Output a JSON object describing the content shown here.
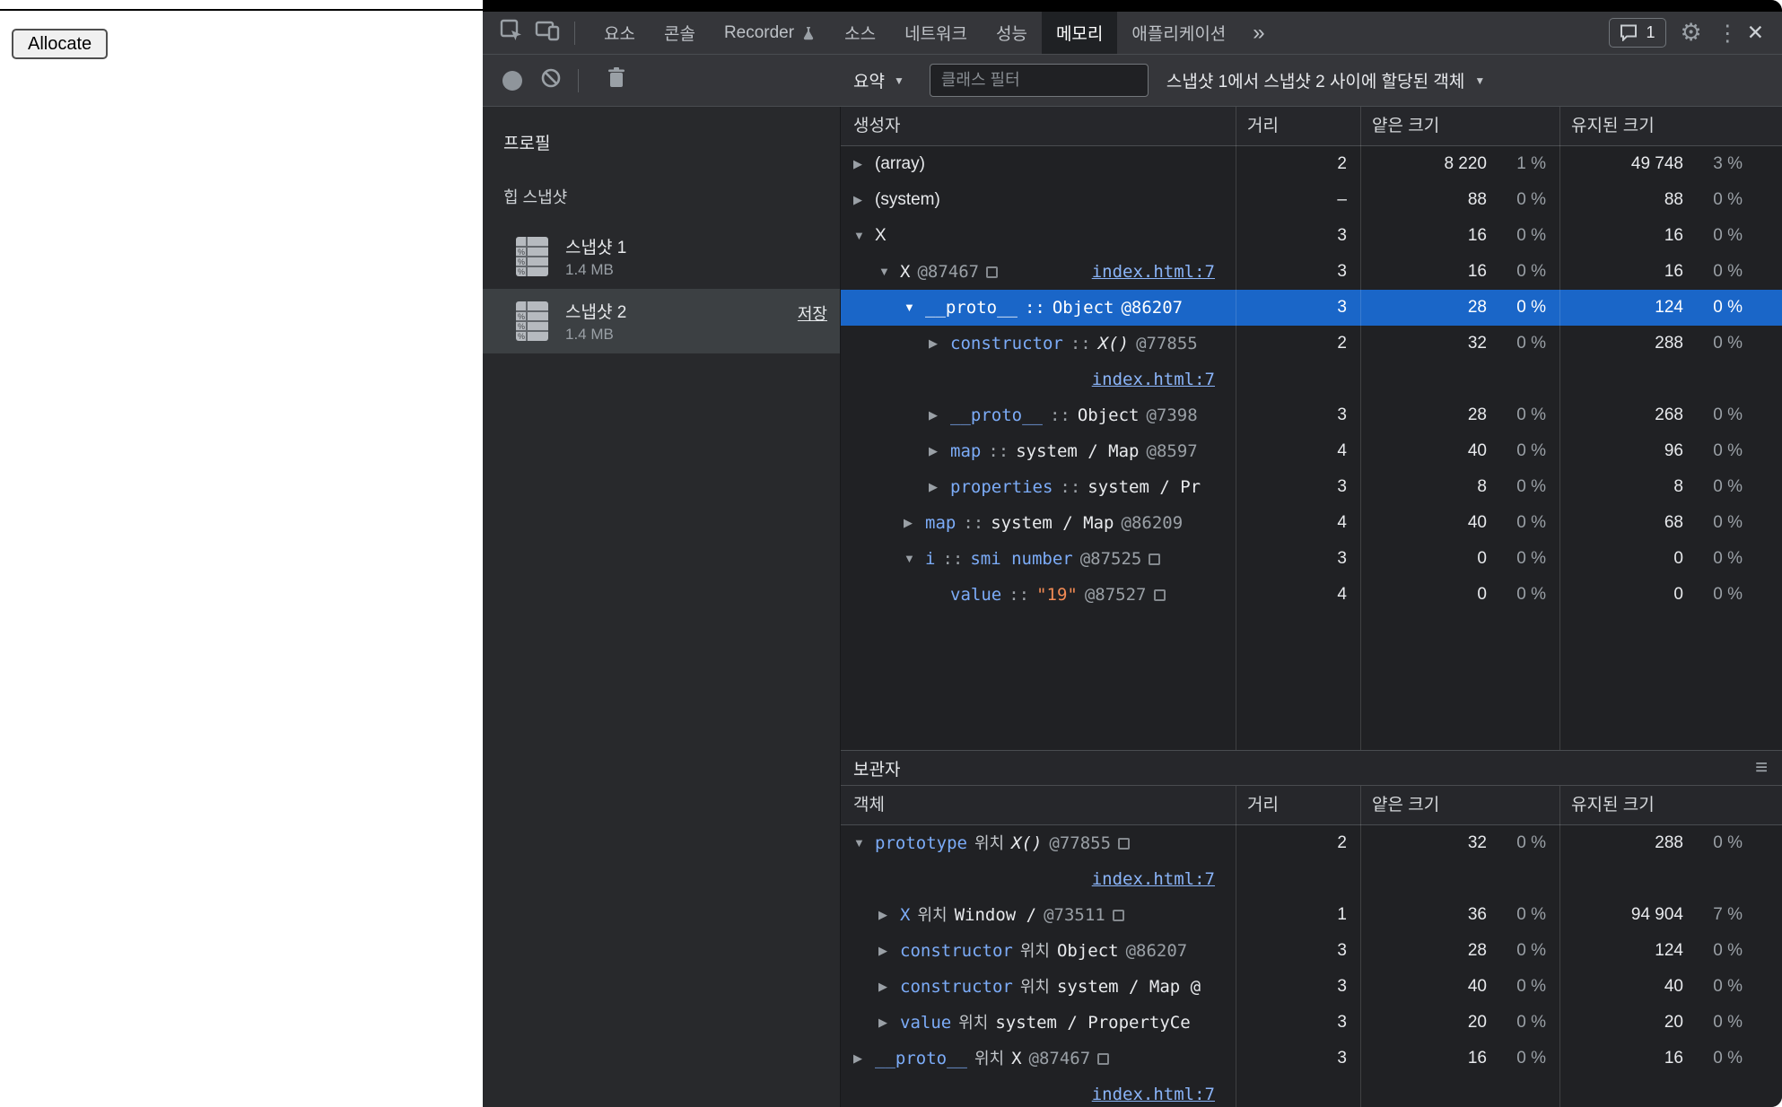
{
  "page": {
    "allocate_button": "Allocate"
  },
  "devtools": {
    "icons": {
      "expanded": "▼",
      "collapsed": "▶",
      "dropdown_arrow": "▼",
      "menu_symbol": "≡"
    },
    "tabbar": {
      "tabs": [
        {
          "label": "요소"
        },
        {
          "label": "콘솔"
        },
        {
          "label": "Recorder",
          "flask": true
        },
        {
          "label": "소스"
        },
        {
          "label": "네트워크"
        },
        {
          "label": "성능"
        },
        {
          "label": "메모리",
          "selected": true
        },
        {
          "label": "애플리케이션"
        }
      ],
      "more_symbol": "»",
      "issues_count": "1",
      "gear_symbol": "⚙",
      "kebab_symbol": "⋮",
      "close_symbol": "✕"
    },
    "toolbar": {
      "summary_label": "요약",
      "filter_placeholder": "클래스 필터",
      "scope_label": "스냅샷 1에서 스냅샷 2 사이에 할당된 객체"
    },
    "sidebar": {
      "title": "프로필",
      "section": "힙 스냅샷",
      "snapshots": [
        {
          "name": "스냅샷 1",
          "size": "1.4 MB"
        },
        {
          "name": "스냅샷 2",
          "size": "1.4 MB",
          "selected": true,
          "save_label": "저장"
        }
      ]
    },
    "constructors": {
      "columns": {
        "name": "생성자",
        "distance": "거리",
        "shallow": "얕은 크기",
        "retained": "유지된 크기"
      },
      "rows": [
        {
          "level": 0,
          "arrow": "collapsed",
          "mono": false,
          "parts": [
            {
              "v": "(array)",
              "c": "pl"
            }
          ],
          "distance": "2",
          "shallow": "8 220",
          "shallow_pct": "1 %",
          "retained": "49 748",
          "retained_pct": "3 %"
        },
        {
          "level": 0,
          "arrow": "collapsed",
          "mono": false,
          "parts": [
            {
              "v": "(system)",
              "c": "pl"
            }
          ],
          "distance": "–",
          "shallow": "88",
          "shallow_pct": "0 %",
          "retained": "88",
          "retained_pct": "0 %"
        },
        {
          "level": 0,
          "arrow": "open",
          "mono": false,
          "parts": [
            {
              "v": "X",
              "c": "pl"
            }
          ],
          "distance": "3",
          "shallow": "16",
          "shallow_pct": "0 %",
          "retained": "16",
          "retained_pct": "0 %"
        },
        {
          "level": 1,
          "arrow": "open",
          "mono": true,
          "parts": [
            {
              "v": "X",
              "c": "pl"
            },
            {
              "v": "@87467",
              "c": "id"
            }
          ],
          "reveal": true,
          "link": "index.html:7",
          "distance": "3",
          "shallow": "16",
          "shallow_pct": "0 %",
          "retained": "16",
          "retained_pct": "0 %"
        },
        {
          "level": 2,
          "arrow": "open",
          "mono": true,
          "selected": true,
          "parts": [
            {
              "v": "__proto__",
              "c": "nm"
            },
            {
              "v": "::",
              "c": "sp"
            },
            {
              "v": "Object",
              "c": "pl"
            },
            {
              "v": "@86207",
              "c": "id"
            }
          ],
          "distance": "3",
          "shallow": "28",
          "shallow_pct": "0 %",
          "retained": "124",
          "retained_pct": "0 %"
        },
        {
          "level": 3,
          "arrow": "collapsed",
          "mono": true,
          "parts": [
            {
              "v": "constructor",
              "c": "nm"
            },
            {
              "v": "::",
              "c": "sp"
            },
            {
              "v": "X()",
              "c": "it"
            },
            {
              "v": "@77855",
              "c": "id"
            }
          ],
          "link2": "index.html:7",
          "distance": "2",
          "shallow": "32",
          "shallow_pct": "0 %",
          "retained": "288",
          "retained_pct": "0 %"
        },
        {
          "level": 3,
          "arrow": "collapsed",
          "mono": true,
          "parts": [
            {
              "v": "__proto__",
              "c": "nm"
            },
            {
              "v": "::",
              "c": "sp"
            },
            {
              "v": "Object",
              "c": "pl"
            },
            {
              "v": "@7398",
              "c": "id"
            }
          ],
          "distance": "3",
          "shallow": "28",
          "shallow_pct": "0 %",
          "retained": "268",
          "retained_pct": "0 %"
        },
        {
          "level": 3,
          "arrow": "collapsed",
          "mono": true,
          "parts": [
            {
              "v": "map",
              "c": "nm"
            },
            {
              "v": "::",
              "c": "sp"
            },
            {
              "v": "system / Map",
              "c": "pl"
            },
            {
              "v": "@8597",
              "c": "id"
            }
          ],
          "distance": "4",
          "shallow": "40",
          "shallow_pct": "0 %",
          "retained": "96",
          "retained_pct": "0 %"
        },
        {
          "level": 3,
          "arrow": "collapsed",
          "mono": true,
          "parts": [
            {
              "v": "properties",
              "c": "nm"
            },
            {
              "v": "::",
              "c": "sp"
            },
            {
              "v": "system / Pr",
              "c": "pl"
            }
          ],
          "distance": "3",
          "shallow": "8",
          "shallow_pct": "0 %",
          "retained": "8",
          "retained_pct": "0 %"
        },
        {
          "level": 2,
          "arrow": "collapsed",
          "mono": true,
          "parts": [
            {
              "v": "map",
              "c": "nm"
            },
            {
              "v": "::",
              "c": "sp"
            },
            {
              "v": "system / Map",
              "c": "pl"
            },
            {
              "v": "@86209",
              "c": "id"
            }
          ],
          "distance": "4",
          "shallow": "40",
          "shallow_pct": "0 %",
          "retained": "68",
          "retained_pct": "0 %"
        },
        {
          "level": 2,
          "arrow": "open",
          "mono": true,
          "parts": [
            {
              "v": "i",
              "c": "nm"
            },
            {
              "v": "::",
              "c": "sp"
            },
            {
              "v": "smi number",
              "c": "bl"
            },
            {
              "v": "@87525",
              "c": "id"
            }
          ],
          "reveal": true,
          "distance": "3",
          "shallow": "0",
          "shallow_pct": "0 %",
          "retained": "0",
          "retained_pct": "0 %"
        },
        {
          "level": 3,
          "arrow": null,
          "mono": true,
          "parts": [
            {
              "v": "value",
              "c": "nm"
            },
            {
              "v": "::",
              "c": "sp"
            },
            {
              "v": "\"19\"",
              "c": "st"
            },
            {
              "v": "@87527",
              "c": "id"
            }
          ],
          "reveal": true,
          "distance": "4",
          "shallow": "0",
          "shallow_pct": "0 %",
          "retained": "0",
          "retained_pct": "0 %"
        }
      ]
    },
    "retainers": {
      "title": "보관자",
      "columns": {
        "name": "객체",
        "distance": "거리",
        "shallow": "얕은 크기",
        "retained": "유지된 크기"
      },
      "rows": [
        {
          "level": 0,
          "arrow": "open",
          "mono": true,
          "parts": [
            {
              "v": "prototype",
              "c": "nm"
            },
            {
              "v": "위치",
              "c": "ko"
            },
            {
              "v": "X()",
              "c": "it"
            },
            {
              "v": "@77855",
              "c": "id"
            }
          ],
          "reveal": true,
          "link2": "index.html:7",
          "distance": "2",
          "shallow": "32",
          "shallow_pct": "0 %",
          "retained": "288",
          "retained_pct": "0 %"
        },
        {
          "level": 1,
          "arrow": "collapsed",
          "mono": true,
          "parts": [
            {
              "v": "X",
              "c": "nm"
            },
            {
              "v": "위치",
              "c": "ko"
            },
            {
              "v": "Window /",
              "c": "pl"
            },
            {
              "v": "@73511",
              "c": "id"
            }
          ],
          "reveal": true,
          "distance": "1",
          "shallow": "36",
          "shallow_pct": "0 %",
          "retained": "94 904",
          "retained_pct": "7 %"
        },
        {
          "level": 1,
          "arrow": "collapsed",
          "mono": true,
          "parts": [
            {
              "v": "constructor",
              "c": "nm"
            },
            {
              "v": "위치",
              "c": "ko"
            },
            {
              "v": "Object",
              "c": "pl"
            },
            {
              "v": "@86207",
              "c": "id"
            }
          ],
          "distance": "3",
          "shallow": "28",
          "shallow_pct": "0 %",
          "retained": "124",
          "retained_pct": "0 %"
        },
        {
          "level": 1,
          "arrow": "collapsed",
          "mono": true,
          "parts": [
            {
              "v": "constructor",
              "c": "nm"
            },
            {
              "v": "위치",
              "c": "ko"
            },
            {
              "v": "system / Map @",
              "c": "pl"
            }
          ],
          "distance": "3",
          "shallow": "40",
          "shallow_pct": "0 %",
          "retained": "40",
          "retained_pct": "0 %"
        },
        {
          "level": 1,
          "arrow": "collapsed",
          "mono": true,
          "parts": [
            {
              "v": "value",
              "c": "nm"
            },
            {
              "v": "위치",
              "c": "ko"
            },
            {
              "v": "system / PropertyCe",
              "c": "pl"
            }
          ],
          "distance": "3",
          "shallow": "20",
          "shallow_pct": "0 %",
          "retained": "20",
          "retained_pct": "0 %"
        },
        {
          "level": 0,
          "arrow": "collapsed",
          "mono": true,
          "parts": [
            {
              "v": "__proto__",
              "c": "nm"
            },
            {
              "v": "위치",
              "c": "ko"
            },
            {
              "v": "X",
              "c": "pl"
            },
            {
              "v": "@87467",
              "c": "id"
            }
          ],
          "reveal": true,
          "link2": "index.html:7",
          "distance": "3",
          "shallow": "16",
          "shallow_pct": "0 %",
          "retained": "16",
          "retained_pct": "0 %"
        }
      ]
    }
  }
}
